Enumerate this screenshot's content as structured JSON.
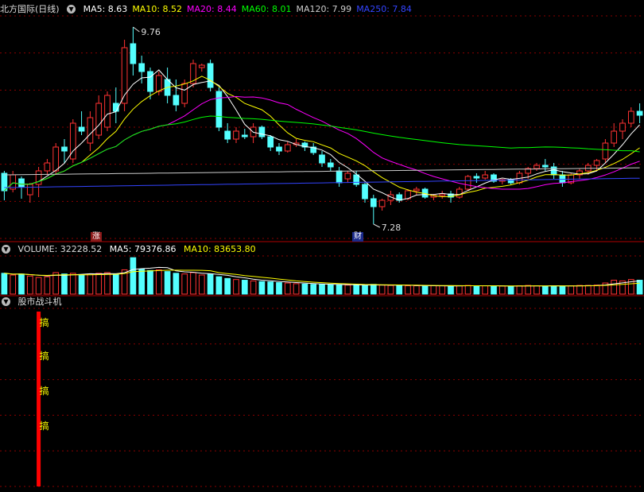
{
  "stock": {
    "title": "北方国际(日线)",
    "ma": [
      {
        "label": "MA5: 8.63",
        "color": "#ffffff"
      },
      {
        "label": "MA10: 8.52",
        "color": "#ffff00"
      },
      {
        "label": "MA20: 8.44",
        "color": "#ff00ff"
      },
      {
        "label": "MA60: 8.01",
        "color": "#00ff00"
      },
      {
        "label": "MA120: 7.99",
        "color": "#cccccc"
      },
      {
        "label": "MA250: 7.84",
        "color": "#3344ff"
      }
    ],
    "high_label": "9.76",
    "low_label": "7.28",
    "badge_zhang": "涨",
    "badge_cai": "财"
  },
  "volume": {
    "title": "VOLUME: 32228.52",
    "ma5": "MA5: 79376.86",
    "ma10": "MA10: 83653.80"
  },
  "indicator": {
    "title": "股市战斗机",
    "label": "搞"
  },
  "colors": {
    "up": "#ff3232",
    "down": "#54ffff",
    "grid": "#8a0000"
  },
  "chart_data": {
    "type": "candlestick",
    "price_range": [
      7.1,
      9.9
    ],
    "candles": [
      [
        7.92,
        7.95,
        7.58,
        7.7
      ],
      [
        7.72,
        7.95,
        7.68,
        7.9
      ],
      [
        7.85,
        7.88,
        7.6,
        7.75
      ],
      [
        7.65,
        7.8,
        7.55,
        7.78
      ],
      [
        7.78,
        8.0,
        7.62,
        7.95
      ],
      [
        7.95,
        8.1,
        7.9,
        8.05
      ],
      [
        7.95,
        8.3,
        7.9,
        8.25
      ],
      [
        8.25,
        8.35,
        8.05,
        8.2
      ],
      [
        8.1,
        8.6,
        8.05,
        8.55
      ],
      [
        8.5,
        8.7,
        8.4,
        8.45
      ],
      [
        8.3,
        8.7,
        8.2,
        8.62
      ],
      [
        8.4,
        8.9,
        8.35,
        8.8
      ],
      [
        8.5,
        8.95,
        8.45,
        8.9
      ],
      [
        8.8,
        9.0,
        8.55,
        8.7
      ],
      [
        8.8,
        9.6,
        8.7,
        9.5
      ],
      [
        9.55,
        9.76,
        9.15,
        9.3
      ],
      [
        9.3,
        9.4,
        9.05,
        9.2
      ],
      [
        9.2,
        9.25,
        8.85,
        8.95
      ],
      [
        8.95,
        9.2,
        8.9,
        9.15
      ],
      [
        9.1,
        9.25,
        8.8,
        8.9
      ],
      [
        8.9,
        9.1,
        8.7,
        8.78
      ],
      [
        8.8,
        9.1,
        8.75,
        9.05
      ],
      [
        9.05,
        9.35,
        9.0,
        9.3
      ],
      [
        9.25,
        9.3,
        9.2,
        9.28
      ],
      [
        9.3,
        9.35,
        8.95,
        9.0
      ],
      [
        8.95,
        9.0,
        8.45,
        8.5
      ],
      [
        8.45,
        8.55,
        8.3,
        8.35
      ],
      [
        8.35,
        8.5,
        8.3,
        8.45
      ],
      [
        8.4,
        8.48,
        8.35,
        8.38
      ],
      [
        8.38,
        8.55,
        8.3,
        8.5
      ],
      [
        8.5,
        8.52,
        8.35,
        8.38
      ],
      [
        8.38,
        8.4,
        8.2,
        8.25
      ],
      [
        8.25,
        8.3,
        8.15,
        8.2
      ],
      [
        8.2,
        8.32,
        8.18,
        8.28
      ],
      [
        8.28,
        8.35,
        8.25,
        8.3
      ],
      [
        8.3,
        8.32,
        8.2,
        8.25
      ],
      [
        8.25,
        8.3,
        8.15,
        8.18
      ],
      [
        8.15,
        8.2,
        8.0,
        8.05
      ],
      [
        8.05,
        8.1,
        7.95,
        8.0
      ],
      [
        7.95,
        8.0,
        7.75,
        7.8
      ],
      [
        7.85,
        7.95,
        7.8,
        7.92
      ],
      [
        7.9,
        7.95,
        7.75,
        7.78
      ],
      [
        7.78,
        7.8,
        7.55,
        7.6
      ],
      [
        7.6,
        7.65,
        7.28,
        7.5
      ],
      [
        7.5,
        7.6,
        7.45,
        7.58
      ],
      [
        7.58,
        7.7,
        7.52,
        7.65
      ],
      [
        7.65,
        7.68,
        7.55,
        7.58
      ],
      [
        7.6,
        7.72,
        7.58,
        7.7
      ],
      [
        7.7,
        7.75,
        7.65,
        7.72
      ],
      [
        7.72,
        7.74,
        7.6,
        7.62
      ],
      [
        7.62,
        7.66,
        7.58,
        7.64
      ],
      [
        7.64,
        7.7,
        7.6,
        7.66
      ],
      [
        7.66,
        7.7,
        7.55,
        7.62
      ],
      [
        7.62,
        7.75,
        7.6,
        7.72
      ],
      [
        7.72,
        7.9,
        7.7,
        7.88
      ],
      [
        7.88,
        7.92,
        7.8,
        7.86
      ],
      [
        7.86,
        7.95,
        7.84,
        7.9
      ],
      [
        7.9,
        7.92,
        7.8,
        7.82
      ],
      [
        7.82,
        7.85,
        7.78,
        7.84
      ],
      [
        7.84,
        7.86,
        7.78,
        7.8
      ],
      [
        7.8,
        7.95,
        7.78,
        7.92
      ],
      [
        7.92,
        8.0,
        7.85,
        7.98
      ],
      [
        7.98,
        8.05,
        7.95,
        8.02
      ],
      [
        8.02,
        8.1,
        7.95,
        8.0
      ],
      [
        8.0,
        8.05,
        7.85,
        7.9
      ],
      [
        7.9,
        7.95,
        7.75,
        7.8
      ],
      [
        7.8,
        7.92,
        7.78,
        7.9
      ],
      [
        7.9,
        7.98,
        7.85,
        7.95
      ],
      [
        7.95,
        8.05,
        7.9,
        8.02
      ],
      [
        8.02,
        8.1,
        7.95,
        8.08
      ],
      [
        8.1,
        8.35,
        8.05,
        8.3
      ],
      [
        8.3,
        8.55,
        8.25,
        8.45
      ],
      [
        8.45,
        8.6,
        8.35,
        8.55
      ],
      [
        8.55,
        8.75,
        8.5,
        8.7
      ],
      [
        8.7,
        8.8,
        8.55,
        8.65
      ]
    ],
    "volume_range": [
      0,
      110000
    ],
    "volumes": [
      60000,
      55000,
      58000,
      52000,
      48000,
      50000,
      62000,
      58000,
      60000,
      55000,
      58000,
      60000,
      62000,
      58000,
      70000,
      105000,
      72000,
      68000,
      70000,
      65000,
      60000,
      58000,
      62000,
      55000,
      58000,
      50000,
      45000,
      42000,
      40000,
      38000,
      36000,
      35000,
      33000,
      32000,
      30000,
      29000,
      28000,
      28000,
      27000,
      27000,
      26000,
      26000,
      25000,
      28000,
      26000,
      25000,
      25000,
      24000,
      24000,
      23000,
      24000,
      24000,
      23000,
      24000,
      25000,
      24000,
      24000,
      23000,
      23000,
      22000,
      24000,
      25000,
      24000,
      23000,
      24000,
      23000,
      24000,
      25000,
      25000,
      26000,
      32000,
      40000,
      38000,
      42000,
      40000
    ],
    "indicator_start_index": 4
  }
}
